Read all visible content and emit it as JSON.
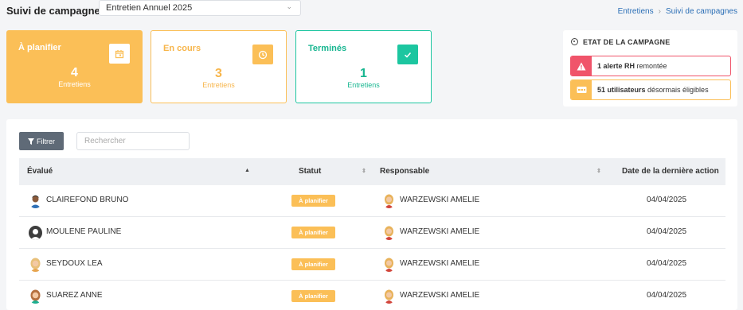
{
  "header": {
    "title": "Suivi de campagnes",
    "campaign_select": "Entretien Annuel 2025",
    "breadcrumb": [
      "Entretiens",
      "Suivi de campagnes"
    ]
  },
  "cards": [
    {
      "title": "À planifier",
      "count": "4",
      "sub": "Entretiens",
      "icon": "calendar-icon",
      "color": "#fbbf57"
    },
    {
      "title": "En cours",
      "count": "3",
      "sub": "Entretiens",
      "icon": "clock-icon",
      "color": "#fbbf57"
    },
    {
      "title": "Terminés",
      "count": "1",
      "sub": "Entretiens",
      "icon": "check-icon",
      "color": "#1cc6a0"
    }
  ],
  "etat": {
    "title": "ETAT DE LA CAMPAGNE",
    "alerts": [
      {
        "bold": "1 alerte RH",
        "rest": " remontée",
        "icon": "warning-icon",
        "color": "#f0546a"
      },
      {
        "bold": "51 utilisateurs",
        "rest": " désormais éligibles",
        "icon": "id-card-icon",
        "color": "#fbbf57"
      }
    ]
  },
  "table": {
    "filter_label": "Filtrer",
    "search_placeholder": "Rechercher",
    "columns": [
      "Évalué",
      "Statut",
      "Responsable",
      "Date de la dernière action"
    ],
    "rows": [
      {
        "evalue": "CLAIREFOND BRUNO",
        "statut": "À planifier",
        "responsable": "WARZEWSKI AMELIE",
        "date": "04/04/2025"
      },
      {
        "evalue": "MOULENE PAULINE",
        "statut": "À planifier",
        "responsable": "WARZEWSKI AMELIE",
        "date": "04/04/2025"
      },
      {
        "evalue": "SEYDOUX LEA",
        "statut": "À planifier",
        "responsable": "WARZEWSKI AMELIE",
        "date": "04/04/2025"
      },
      {
        "evalue": "SUAREZ ANNE",
        "statut": "À planifier",
        "responsable": "WARZEWSKI AMELIE",
        "date": "04/04/2025"
      }
    ]
  }
}
